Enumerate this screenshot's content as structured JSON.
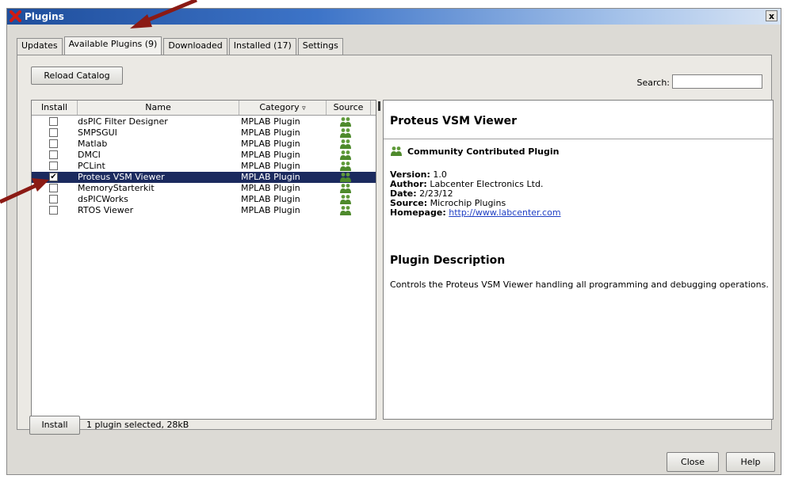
{
  "window": {
    "title": "Plugins",
    "close_label": "x"
  },
  "tabs": [
    {
      "label": "Updates"
    },
    {
      "label": "Available Plugins (9)"
    },
    {
      "label": "Downloaded"
    },
    {
      "label": "Installed (17)"
    },
    {
      "label": "Settings"
    }
  ],
  "toolbar": {
    "reload_label": "Reload Catalog",
    "search_label": "Search:",
    "search_value": ""
  },
  "table": {
    "columns": [
      "Install",
      "Name",
      "Category",
      "Source"
    ],
    "sort_glyph": "▿",
    "rows": [
      {
        "installed": false,
        "name": "dsPIC Filter Designer",
        "category": "MPLAB Plugin"
      },
      {
        "installed": false,
        "name": "SMPSGUI",
        "category": "MPLAB Plugin"
      },
      {
        "installed": false,
        "name": "Matlab",
        "category": "MPLAB Plugin"
      },
      {
        "installed": false,
        "name": "DMCI",
        "category": "MPLAB Plugin"
      },
      {
        "installed": false,
        "name": "PCLint",
        "category": "MPLAB Plugin"
      },
      {
        "installed": true,
        "name": "Proteus VSM Viewer",
        "category": "MPLAB Plugin",
        "selected": true
      },
      {
        "installed": false,
        "name": "MemoryStarterkit",
        "category": "MPLAB Plugin"
      },
      {
        "installed": false,
        "name": "dsPICWorks",
        "category": "MPLAB Plugin"
      },
      {
        "installed": false,
        "name": "RTOS Viewer",
        "category": "MPLAB Plugin"
      }
    ]
  },
  "detail": {
    "title": "Proteus VSM Viewer",
    "badge": "Community Contributed Plugin",
    "version_label": "Version:",
    "version": "1.0",
    "author_label": "Author:",
    "author": "Labcenter Electronics Ltd.",
    "date_label": "Date:",
    "date": "2/23/12",
    "source_label": "Source:",
    "source": "Microchip Plugins",
    "homepage_label": "Homepage:",
    "homepage": "http://www.labcenter.com",
    "desc_heading": "Plugin Description",
    "description": "Controls the Proteus VSM Viewer handling all programming and debugging operations."
  },
  "footer": {
    "install_label": "Install",
    "status": "1 plugin selected, 28kB",
    "close_label": "Close",
    "help_label": "Help"
  },
  "colors": {
    "selection": "#1b2a5e",
    "annotation_arrow": "#8b1a14",
    "link": "#1f3fc4"
  },
  "icons": {
    "app": "red-x-icon",
    "source": "community-people-icon"
  }
}
